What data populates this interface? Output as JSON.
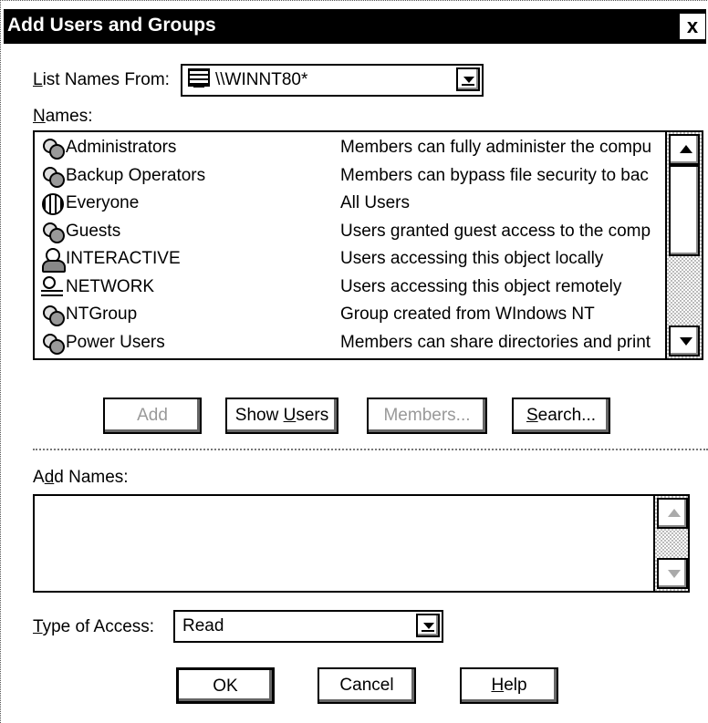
{
  "dialog": {
    "title": "Add Users and Groups",
    "close_label": "x"
  },
  "list_names_from": {
    "label": "List Names From:",
    "value": "\\\\WINNT80*"
  },
  "names": {
    "label": "Names:",
    "rows": [
      {
        "name": "Administrators",
        "description": "Members can fully administer the compu",
        "icon": "group-icon"
      },
      {
        "name": "Backup Operators",
        "description": "Members can bypass file security to bac",
        "icon": "group-icon"
      },
      {
        "name": "Everyone",
        "description": "All Users",
        "icon": "globe-icon"
      },
      {
        "name": "Guests",
        "description": "Users granted guest access to the comp",
        "icon": "group-icon"
      },
      {
        "name": "INTERACTIVE",
        "description": "Users accessing this object locally",
        "icon": "user-icon"
      },
      {
        "name": "NETWORK",
        "description": "Users accessing this object remotely",
        "icon": "network-user-icon"
      },
      {
        "name": "NTGroup",
        "description": "Group created from WIndows NT",
        "icon": "group-icon"
      },
      {
        "name": "Power Users",
        "description": "Members can share directories and print",
        "icon": "group-icon"
      }
    ]
  },
  "buttons": {
    "add": "Add",
    "show_users": "Show Users",
    "members": "Members...",
    "search": "Search...",
    "ok": "OK",
    "cancel": "Cancel",
    "help": "Help"
  },
  "add_names": {
    "label": "Add Names:",
    "value": ""
  },
  "type_of_access": {
    "label": "Type of Access:",
    "value": "Read"
  }
}
